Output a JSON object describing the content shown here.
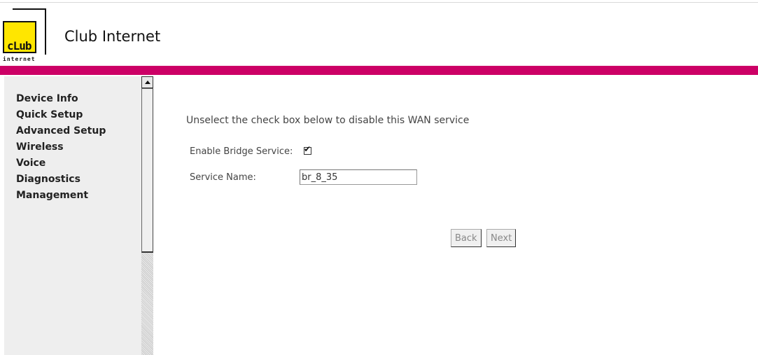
{
  "brand": {
    "logo_text": "cLub",
    "logo_sub": "internet",
    "name": "Club Internet"
  },
  "colors": {
    "accent_bar": "#cc0066",
    "logo_yellow": "#ffe600",
    "sidebar_bg": "#eeeeee"
  },
  "sidebar": {
    "items": [
      {
        "label": "Device Info"
      },
      {
        "label": "Quick Setup"
      },
      {
        "label": "Advanced Setup"
      },
      {
        "label": "Wireless"
      },
      {
        "label": "Voice"
      },
      {
        "label": "Diagnostics"
      },
      {
        "label": "Management"
      }
    ]
  },
  "form": {
    "instruction": "Unselect the check box below to disable this WAN service",
    "enable_bridge_label": "Enable Bridge Service:",
    "enable_bridge_checked": true,
    "service_name_label": "Service Name:",
    "service_name_value": "br_8_35"
  },
  "buttons": {
    "back_label": "Back",
    "next_label": "Next"
  },
  "icons": {
    "scroll_up": "arrow-up-icon",
    "checkbox": "checkmark-icon"
  }
}
